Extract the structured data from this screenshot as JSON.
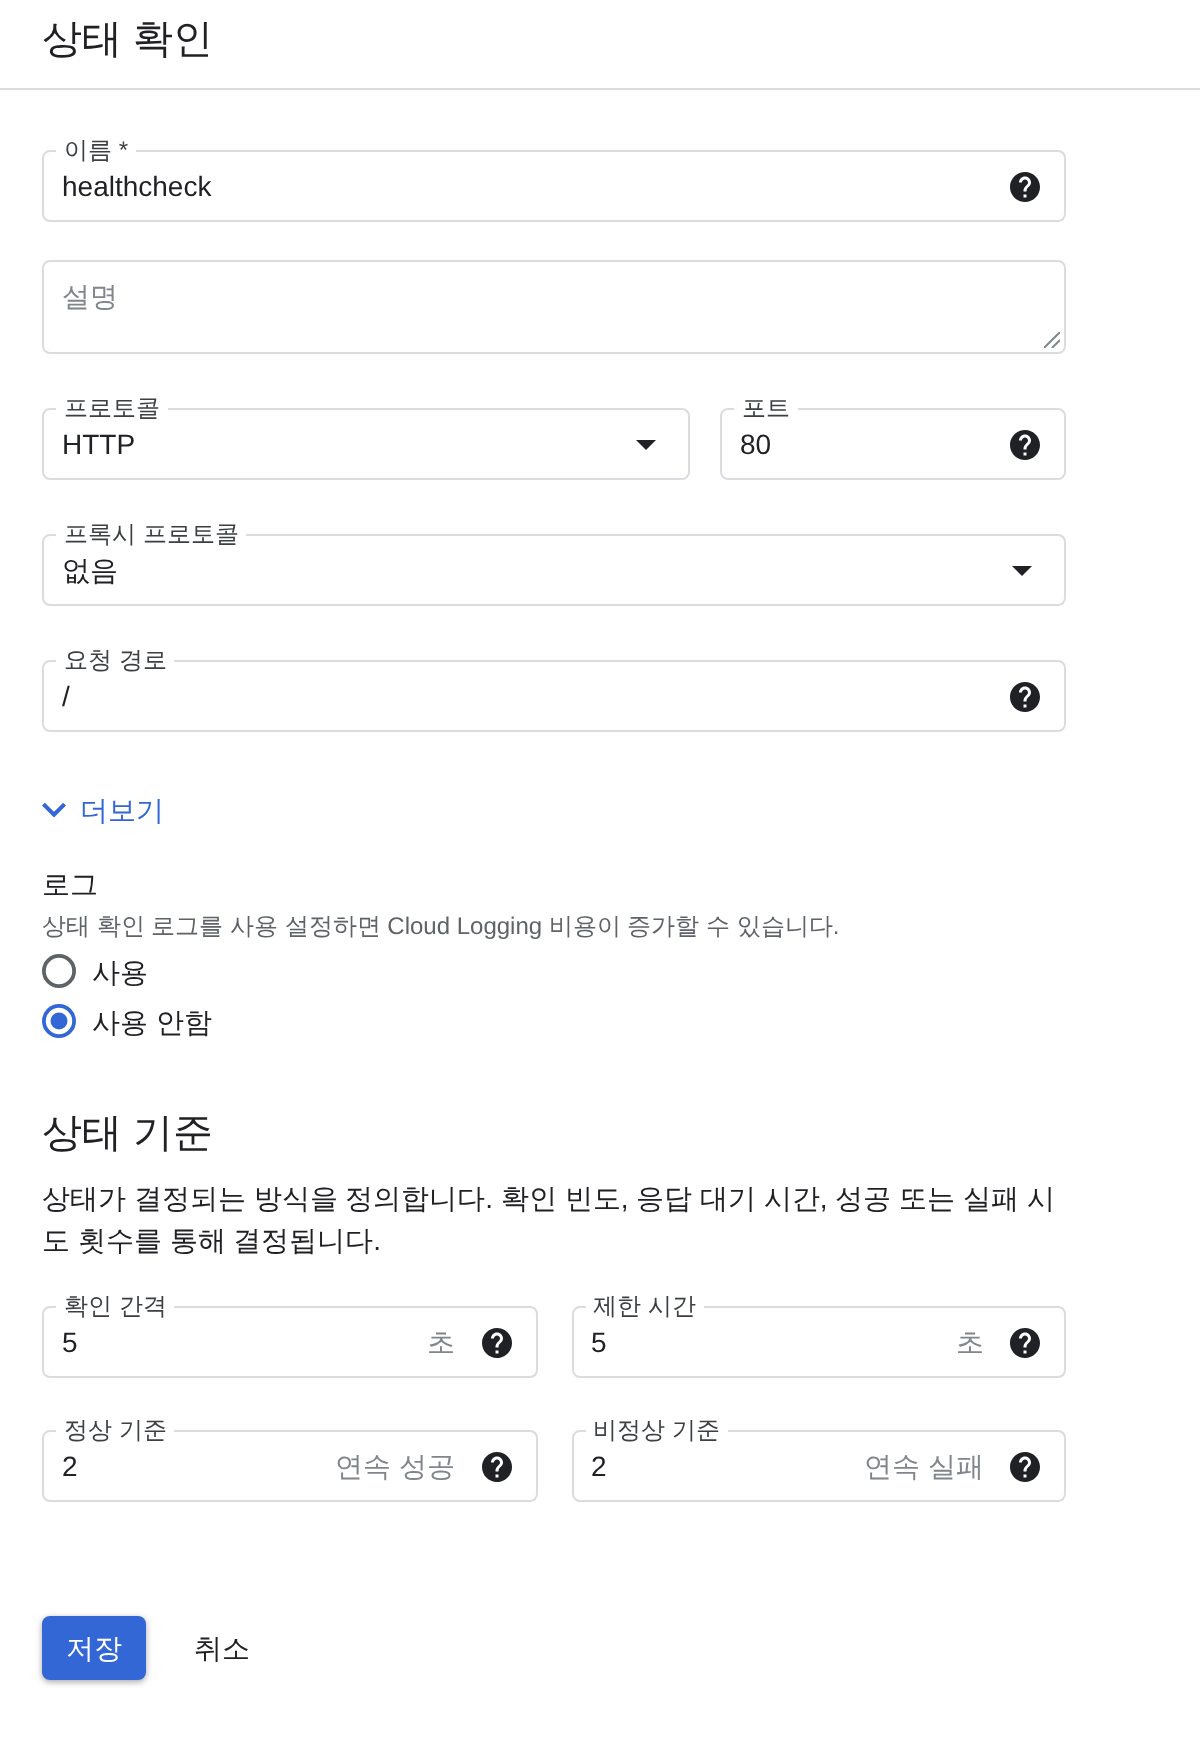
{
  "header": {
    "title": "상태 확인"
  },
  "rows": [
    [
      {
        "kind": "text",
        "label": "이름 *",
        "value": "healthcheck",
        "help": true
      }
    ],
    [
      {
        "kind": "textarea",
        "placeholder": "설명"
      }
    ],
    [
      {
        "kind": "select",
        "label": "프로토콜",
        "value": "HTTP",
        "help": false
      },
      {
        "kind": "text",
        "label": "포트",
        "value": "80",
        "help": true
      }
    ],
    [
      {
        "kind": "select",
        "label": "프록시 프로토콜",
        "value": "없음",
        "help": false
      }
    ],
    [
      {
        "kind": "text",
        "label": "요청 경로",
        "value": "/",
        "help": true
      }
    ]
  ],
  "more": {
    "label": "더보기",
    "expanded": false
  },
  "logging": {
    "title": "로그",
    "description": "상태 확인 로그를 사용 설정하면 Cloud Logging 비용이 증가할 수 있습니다.",
    "options": [
      {
        "label": "사용",
        "selected": false
      },
      {
        "label": "사용 안함",
        "selected": true
      }
    ]
  },
  "criteria": {
    "title": "상태 기준",
    "description": "상태가 결정되는 방식을 정의합니다. 확인 빈도, 응답 대기 시간, 성공 또는 실패 시도 횟수를 통해 결정됩니다.",
    "rows": [
      [
        {
          "kind": "text",
          "label": "확인 간격",
          "value": "5",
          "unit": "초",
          "help": true
        },
        {
          "kind": "text",
          "label": "제한 시간",
          "value": "5",
          "unit": "초",
          "help": true
        }
      ],
      [
        {
          "kind": "text",
          "label": "정상 기준",
          "value": "2",
          "unit": "연속 성공",
          "help": true
        },
        {
          "kind": "text",
          "label": "비정상 기준",
          "value": "2",
          "unit": "연속 실패",
          "help": true
        }
      ]
    ]
  },
  "actions": [
    {
      "kind": "primary",
      "label": "저장"
    },
    {
      "kind": "text",
      "label": "취소"
    }
  ]
}
